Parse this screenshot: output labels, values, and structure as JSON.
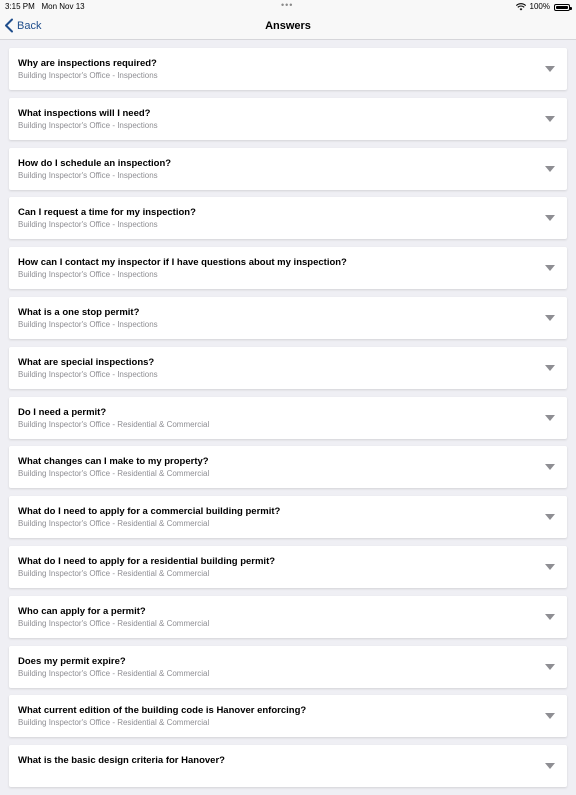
{
  "status": {
    "time": "3:15 PM",
    "date": "Mon Nov 13",
    "more": "•••",
    "battery": "100%"
  },
  "nav": {
    "back": "Back",
    "title": "Answers"
  },
  "items": [
    {
      "q": "Why are inspections required?",
      "sub": "Building Inspector's Office - Inspections"
    },
    {
      "q": "What inspections will I need?",
      "sub": "Building Inspector's Office - Inspections"
    },
    {
      "q": "How do I schedule an inspection?",
      "sub": "Building Inspector's Office - Inspections"
    },
    {
      "q": "Can I request a time for my inspection?",
      "sub": "Building Inspector's Office - Inspections"
    },
    {
      "q": "How can I contact my inspector if I have questions about my inspection?",
      "sub": "Building Inspector's Office - Inspections"
    },
    {
      "q": "What is a one stop permit?",
      "sub": "Building Inspector's Office - Inspections"
    },
    {
      "q": "What are special inspections?",
      "sub": "Building Inspector's Office - Inspections"
    },
    {
      "q": "Do I need a permit?",
      "sub": "Building Inspector's Office - Residential & Commercial"
    },
    {
      "q": "What changes can I make to my property?",
      "sub": "Building Inspector's Office - Residential & Commercial"
    },
    {
      "q": "What do I need to apply for a commercial building permit?",
      "sub": "Building Inspector's Office - Residential & Commercial"
    },
    {
      "q": "What do I need to apply for a residential building permit?",
      "sub": "Building Inspector's Office - Residential & Commercial"
    },
    {
      "q": "Who can apply for a permit?",
      "sub": "Building Inspector's Office - Residential & Commercial"
    },
    {
      "q": "Does my permit expire?",
      "sub": "Building Inspector's Office - Residential & Commercial"
    },
    {
      "q": "What current edition of the building code is Hanover enforcing?",
      "sub": "Building Inspector's Office - Residential & Commercial"
    },
    {
      "q": "What is the basic design criteria for Hanover?",
      "sub": ""
    }
  ],
  "icons": {
    "back": "chevron-left-icon",
    "expand": "chevron-down-icon",
    "wifi": "wifi-icon",
    "battery": "battery-icon"
  },
  "colors": {
    "accent": "#1f4e8c",
    "subtitle": "#8e8e93",
    "background": "#efeff4"
  }
}
